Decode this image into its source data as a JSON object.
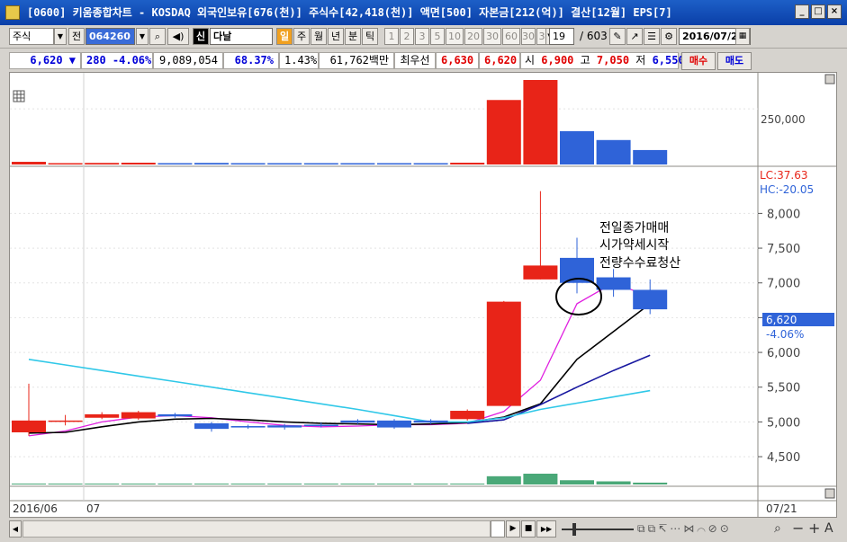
{
  "window": {
    "title": "[0600] 키움종합차트 - KOSDAQ 외국인보유[676(천)] 주식수[42,418(천)] 액면[500] 자본금[212(억)] 결산[12월] EPS[7]",
    "controls": [
      "min",
      "max",
      "close"
    ]
  },
  "toolbar": {
    "market_type": "주식",
    "prev_label": "전",
    "stock_code": "064260",
    "stock_name": "다날",
    "period_buttons": [
      "일",
      "주",
      "월",
      "년",
      "분",
      "틱"
    ],
    "active_period": "일",
    "minute_buttons": [
      "1",
      "2",
      "3",
      "5",
      "10",
      "20",
      "30",
      "60",
      "30",
      "3"
    ],
    "count_value": "19",
    "count_total": "/ 603",
    "date_value": "2016/07/2"
  },
  "quote": {
    "price": "6,620",
    "change": "280 -4.06%",
    "volume": "9,089,054",
    "ratio1": "68.37%",
    "ratio2": "1.43%",
    "amount": "61,762백만",
    "best_label": "최우선",
    "best_ask": "6,630",
    "best_bid": "6,620",
    "open_label": "시",
    "open": "6,900",
    "high_label": "고",
    "high": "7,050",
    "low_label": "저",
    "low": "6,550",
    "buy_label": "매수",
    "sell_label": "매도"
  },
  "colors": {
    "up": "#e82418",
    "down": "#2f63d8",
    "ma5": "#e020e0",
    "ma10": "#000000",
    "ma20": "#1818a0",
    "ma60": "#30c8e8",
    "volume_bottom": "#4aa878"
  },
  "chart_data": {
    "type": "candlestick",
    "x_labels": [
      "2016/06",
      "07",
      "07/21"
    ],
    "price_axis": {
      "ticks": [
        "8,000",
        "7,500",
        "7,000",
        "6,500",
        "6,000",
        "5,500",
        "5,000",
        "4,500"
      ],
      "range": [
        4100,
        8600
      ]
    },
    "volume_axis": {
      "ticks": [
        "250,000"
      ],
      "range": [
        0,
        380000
      ]
    },
    "lc_label": "LC:37.63",
    "hc_label": "HC:-20.05",
    "current_price_label": "6,620",
    "current_change_label": "-4.06%",
    "annotation": [
      "전일종가매매",
      "시가약세시작",
      "전량수수료청산"
    ],
    "candles": [
      {
        "o": 4850,
        "c": 5020,
        "h": 5550,
        "l": 4800,
        "v": 12000
      },
      {
        "o": 5020,
        "c": 5020,
        "h": 5100,
        "l": 4950,
        "v": 6000
      },
      {
        "o": 5060,
        "c": 5110,
        "h": 5140,
        "l": 5040,
        "v": 7000
      },
      {
        "o": 5050,
        "c": 5140,
        "h": 5160,
        "l": 5030,
        "v": 8000
      },
      {
        "o": 5110,
        "c": 5080,
        "h": 5130,
        "l": 5060,
        "v": 6000
      },
      {
        "o": 4980,
        "c": 4900,
        "h": 5000,
        "l": 4860,
        "v": 7000
      },
      {
        "o": 4940,
        "c": 4920,
        "h": 4960,
        "l": 4900,
        "v": 5000
      },
      {
        "o": 4950,
        "c": 4920,
        "h": 4970,
        "l": 4890,
        "v": 5000
      },
      {
        "o": 4960,
        "c": 4940,
        "h": 4990,
        "l": 4920,
        "v": 5000
      },
      {
        "o": 5020,
        "c": 4990,
        "h": 5040,
        "l": 4970,
        "v": 5000
      },
      {
        "o": 5020,
        "c": 4920,
        "h": 5040,
        "l": 4900,
        "v": 6000
      },
      {
        "o": 5020,
        "c": 4990,
        "h": 5040,
        "l": 4970,
        "v": 5000
      },
      {
        "o": 5040,
        "c": 5160,
        "h": 5180,
        "l": 5020,
        "v": 8000
      },
      {
        "o": 5230,
        "c": 6730,
        "h": 6740,
        "l": 5230,
        "v": 290000
      },
      {
        "o": 7050,
        "c": 7250,
        "h": 8320,
        "l": 7050,
        "v": 380000
      },
      {
        "o": 7360,
        "c": 7000,
        "h": 7650,
        "l": 6850,
        "v": 150000
      },
      {
        "o": 7080,
        "c": 6900,
        "h": 7200,
        "l": 6800,
        "v": 110000
      },
      {
        "o": 6900,
        "c": 6620,
        "h": 7050,
        "l": 6550,
        "v": 65000
      }
    ],
    "ma_lines": [
      {
        "name": "ma5",
        "values": [
          4800,
          4870,
          5000,
          5070,
          5090,
          5060,
          5000,
          4950,
          4930,
          4940,
          4960,
          4960,
          4980,
          5150,
          5600,
          6700,
          7000,
          6800
        ]
      },
      {
        "name": "ma10",
        "values": [
          4840,
          4850,
          4930,
          5000,
          5040,
          5050,
          5030,
          5000,
          4980,
          4970,
          4960,
          4970,
          4990,
          5070,
          5260,
          5900,
          6300,
          6700
        ]
      },
      {
        "name": "ma20",
        "values": [
          null,
          null,
          null,
          null,
          null,
          null,
          null,
          null,
          null,
          null,
          null,
          null,
          4980,
          5030,
          5250,
          5500,
          5740,
          5960
        ]
      },
      {
        "name": "ma60",
        "values": [
          5900,
          5820,
          5740,
          5660,
          5580,
          5500,
          5420,
          5340,
          5260,
          5180,
          5090,
          5000,
          5000,
          5060,
          5180,
          5270,
          5360,
          5450
        ]
      }
    ]
  },
  "bottom": {
    "nav_buttons": [
      "▶",
      "■",
      "▶▶"
    ]
  }
}
